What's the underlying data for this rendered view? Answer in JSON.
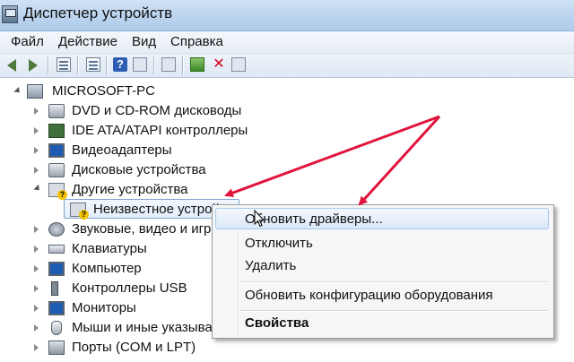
{
  "window": {
    "title": "Диспетчер устройств"
  },
  "menubar": {
    "items": [
      "Файл",
      "Действие",
      "Вид",
      "Справка"
    ]
  },
  "toolbar": {
    "icons": [
      "back-icon",
      "forward-icon",
      "show-hide-tree-icon",
      "properties-icon",
      "help-icon",
      "view-icon",
      "scan-hardware-icon",
      "update-driver-icon",
      "uninstall-icon",
      "disable-icon"
    ]
  },
  "tree": {
    "root": "MICROSOFT-PC",
    "items": [
      {
        "label": "DVD и CD-ROM дисководы",
        "icon": "dvd-drive-icon"
      },
      {
        "label": "IDE ATA/ATAPI контроллеры",
        "icon": "ide-controller-icon"
      },
      {
        "label": "Видеоадаптеры",
        "icon": "display-adapter-icon"
      },
      {
        "label": "Дисковые устройства",
        "icon": "disk-drive-icon"
      },
      {
        "label": "Другие устройства",
        "icon": "other-devices-icon"
      },
      {
        "label": "Неизвестное устрой",
        "icon": "unknown-device-icon"
      },
      {
        "label": "Звуковые, видео и игр",
        "icon": "sound-video-icon"
      },
      {
        "label": "Клавиатуры",
        "icon": "keyboard-icon"
      },
      {
        "label": "Компьютер",
        "icon": "computer-icon"
      },
      {
        "label": "Контроллеры USB",
        "icon": "usb-controller-icon"
      },
      {
        "label": "Мониторы",
        "icon": "monitor-icon"
      },
      {
        "label": "Мыши и иные указыва",
        "icon": "mouse-icon"
      },
      {
        "label": "Порты (COM и LPT)",
        "icon": "ports-icon"
      }
    ]
  },
  "context_menu": {
    "update_drivers": "Обновить драйверы...",
    "disable": "Отключить",
    "uninstall": "Удалить",
    "scan_hardware": "Обновить конфигурацию оборудования",
    "properties": "Свойства"
  },
  "colors": {
    "annotation_arrow": "#e0143c",
    "selection_border": "#7da2ce"
  }
}
